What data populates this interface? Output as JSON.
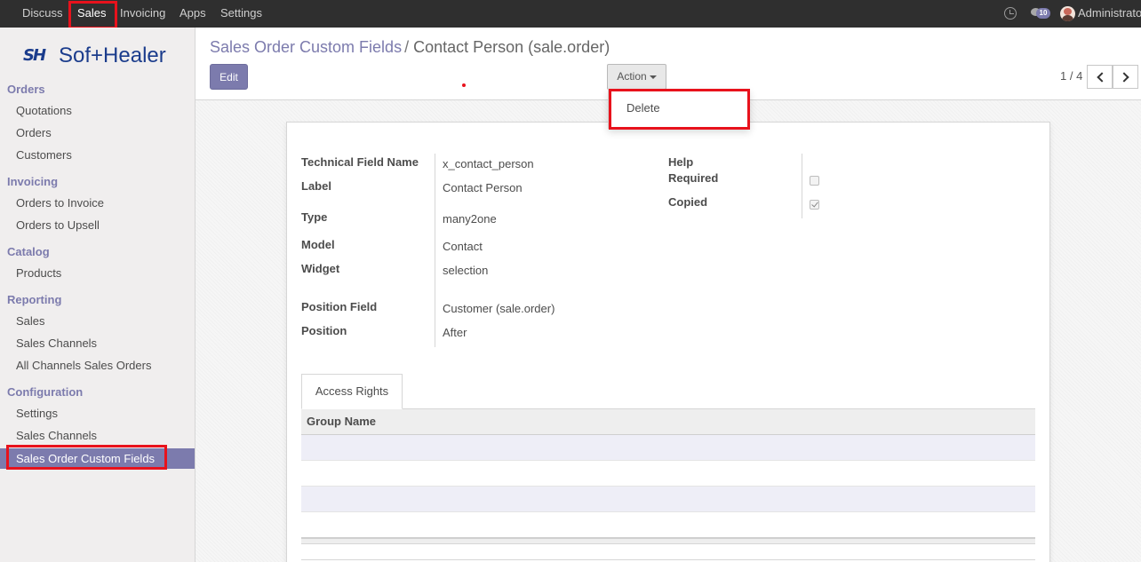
{
  "topbar": {
    "menu": [
      "Discuss",
      "Sales",
      "Invoicing",
      "Apps",
      "Settings"
    ],
    "active": "Sales",
    "notification_count": "10",
    "user": "Administrator",
    "icons": [
      "clock-icon",
      "chat-icon",
      "avatar"
    ]
  },
  "brand": {
    "mark": "SH",
    "name": "Sof+Healer",
    "color": "#1b3c8c"
  },
  "sidebar": {
    "sections": [
      {
        "title": "Orders",
        "items": [
          "Quotations",
          "Orders",
          "Customers"
        ]
      },
      {
        "title": "Invoicing",
        "items": [
          "Orders to Invoice",
          "Orders to Upsell"
        ]
      },
      {
        "title": "Catalog",
        "items": [
          "Products"
        ]
      },
      {
        "title": "Reporting",
        "items": [
          "Sales",
          "Sales Channels",
          "All Channels Sales Orders"
        ]
      },
      {
        "title": "Configuration",
        "items": [
          "Settings",
          "Sales Channels",
          "Sales Order Custom Fields"
        ]
      }
    ],
    "active_item": "Sales Order Custom Fields"
  },
  "control_panel": {
    "breadcrumb_parent": "Sales Order Custom Fields",
    "breadcrumb_separator": "/",
    "breadcrumb_current": "Contact Person (sale.order)",
    "edit_label": "Edit",
    "action_label": "Action",
    "pager": "1 / 4"
  },
  "dropdown": {
    "items": [
      "Delete"
    ]
  },
  "form": {
    "left": [
      {
        "label": "Technical Field Name",
        "value": "x_contact_person"
      },
      {
        "label": "Label",
        "value": "Contact Person"
      },
      {
        "label": "Type",
        "value": "many2one"
      },
      {
        "label": "Model",
        "value": "Contact"
      },
      {
        "label": "Widget",
        "value": "selection"
      },
      {
        "label": "Position Field",
        "value": "Customer (sale.order)"
      },
      {
        "label": "Position",
        "value": "After"
      }
    ],
    "right": [
      {
        "label": "Help",
        "checked": null
      },
      {
        "label": "Required",
        "checked": false
      },
      {
        "label": "Copied",
        "checked": true
      }
    ]
  },
  "tabs": [
    "Access Rights"
  ],
  "table": {
    "columns": [
      "Group Name"
    ],
    "rows": []
  },
  "colors": {
    "accent": "#7c7bad",
    "highlight": "#e8121c",
    "navbar": "#2f2f2f"
  }
}
